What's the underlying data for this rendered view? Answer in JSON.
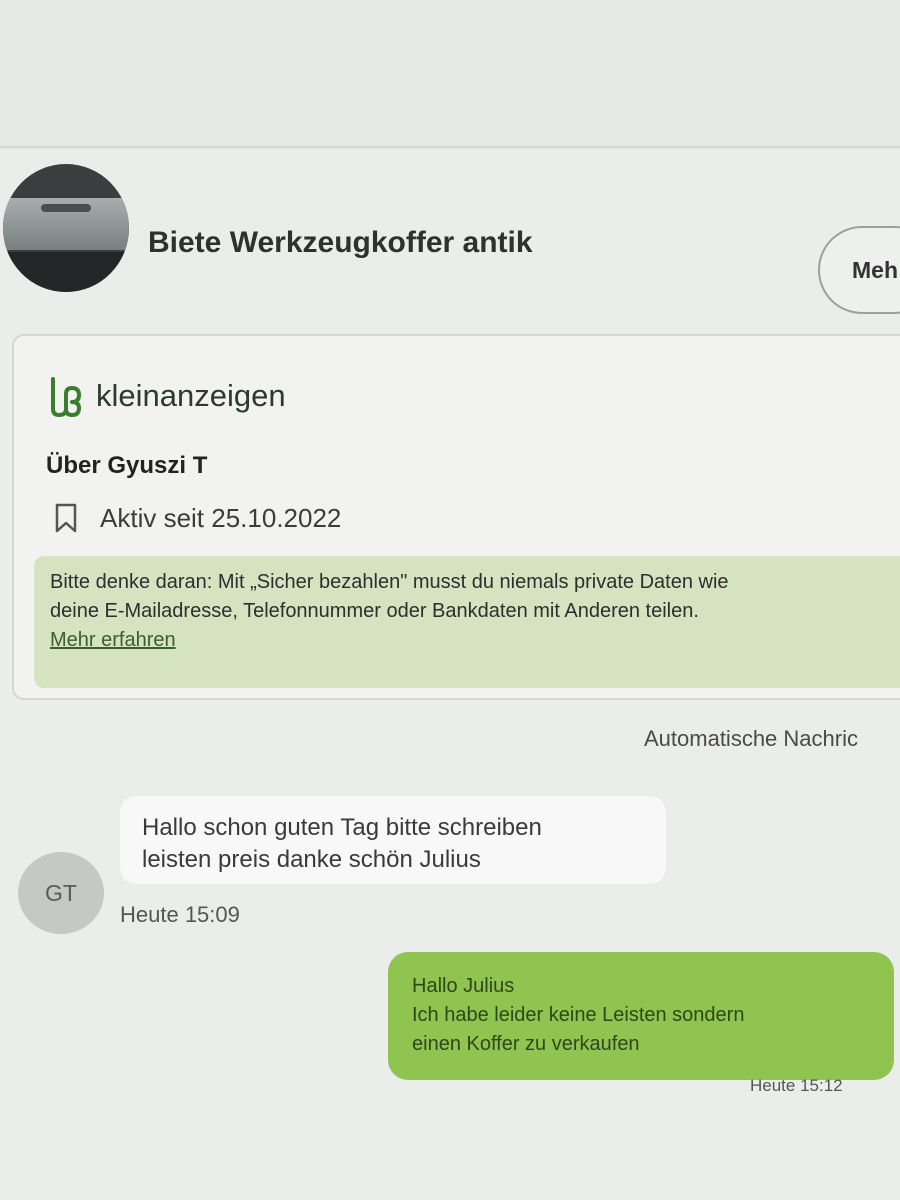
{
  "listing": {
    "title": "Biete Werkzeugkoffer antik",
    "more_button_label": "Meh"
  },
  "seller_card": {
    "brand": "kleinanzeigen",
    "about_title": "Über Gyuszi T",
    "active_since": "Aktiv seit 25.10.2022",
    "notice": {
      "line_1": "Bitte denke daran: Mit „Sicher bezahlen\" musst du niemals private Daten wie",
      "line_2": "deine E-Mailadresse, Telefonnummer oder Bankdaten mit Anderen teilen.",
      "link": "Mehr erfahren"
    },
    "colors": {
      "brand_icon": "#3a7d2c",
      "notice_background": "#d6e3c1"
    }
  },
  "conversation": {
    "auto_message_label": "Automatische Nachric",
    "messages": [
      {
        "direction": "incoming",
        "avatar_initials": "GT",
        "lines": [
          "Hallo schon guten Tag bitte schreiben",
          "leisten preis danke schön Julius"
        ],
        "time": "Heute 15:09"
      },
      {
        "direction": "outgoing",
        "lines": [
          "Hallo Julius",
          "Ich habe leider keine Leisten sondern",
          "einen Koffer zu verkaufen"
        ],
        "time": "Heute 15:12"
      }
    ],
    "colors": {
      "outgoing_bubble": "#8fc450",
      "incoming_bubble": "#f7f8f7"
    }
  },
  "icons": {
    "brand_logo": "kleinanzeigen-logo-icon",
    "active_since": "bookmark-icon"
  }
}
